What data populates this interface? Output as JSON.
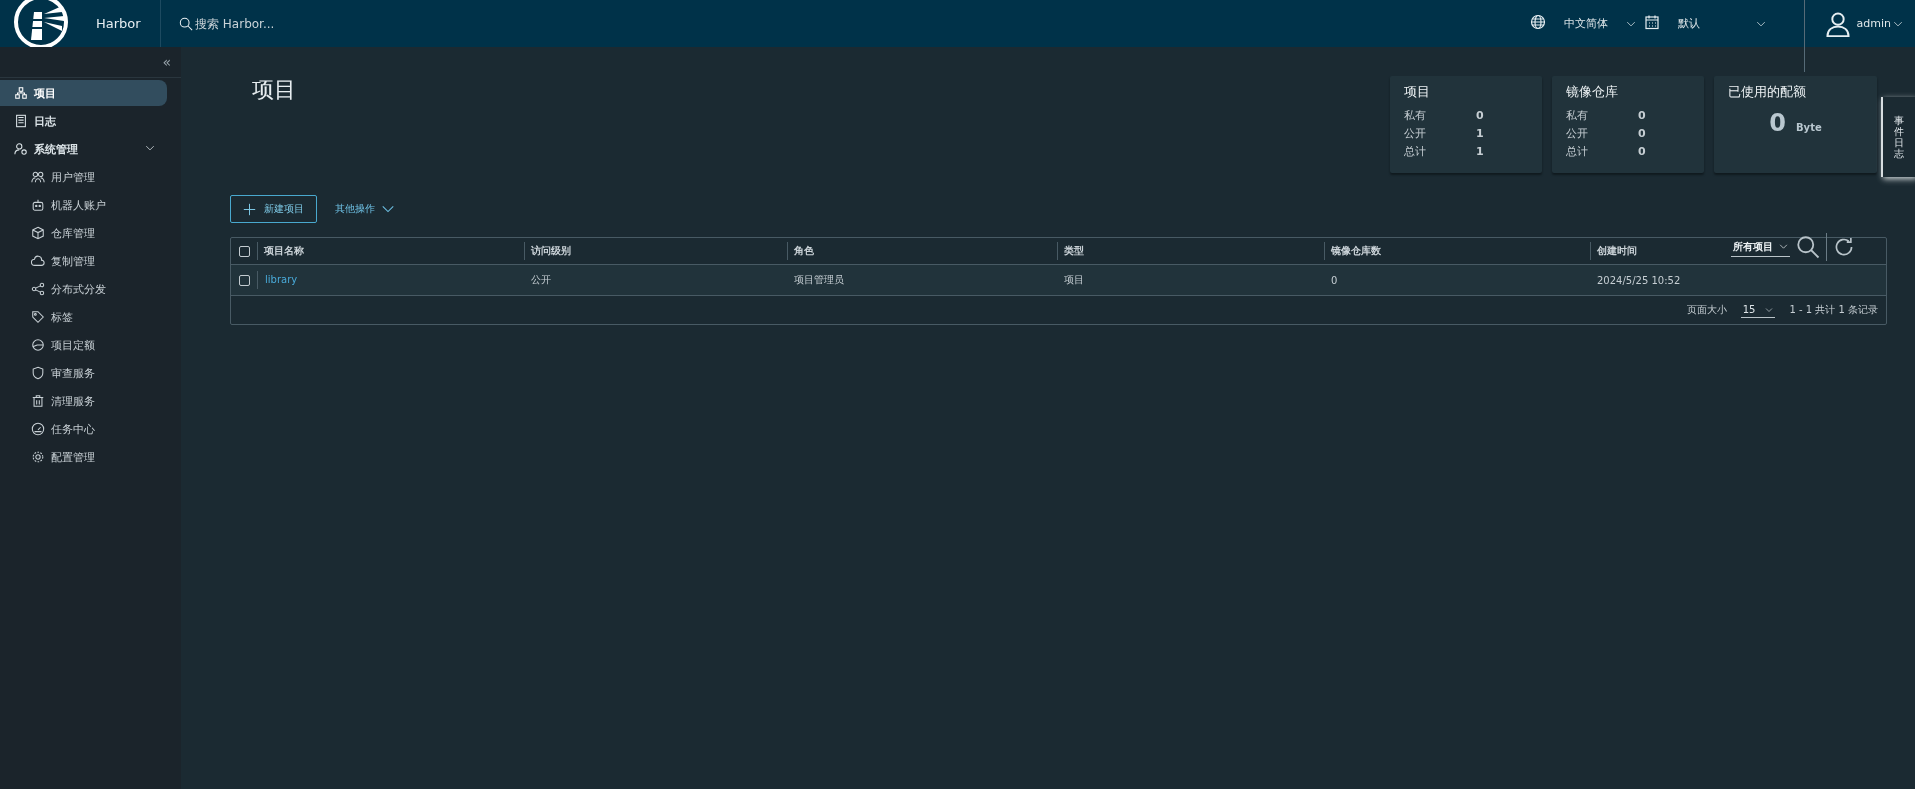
{
  "header": {
    "product": "Harbor",
    "search": {
      "placeholder": "搜索 Harbor..."
    },
    "language": "中文简体",
    "datetime_format": "默认",
    "user": "admin"
  },
  "sidebar": {
    "collapse": "«",
    "items": [
      {
        "label": "项目",
        "selected": true
      },
      {
        "label": "日志",
        "selected": false
      },
      {
        "label": "系统管理",
        "selected": false,
        "expanded": true,
        "children": [
          {
            "label": "用户管理",
            "selected": false
          },
          {
            "label": "机器人账户",
            "selected": false
          },
          {
            "label": "仓库管理",
            "selected": false
          },
          {
            "label": "复制管理",
            "selected": false
          },
          {
            "label": "分布式分发",
            "selected": false
          },
          {
            "label": "标签",
            "selected": false
          },
          {
            "label": "项目定额",
            "selected": false
          },
          {
            "label": "审查服务",
            "selected": false
          },
          {
            "label": "清理服务",
            "selected": false
          },
          {
            "label": "任务中心",
            "selected": false
          },
          {
            "label": "配置管理",
            "selected": false
          }
        ]
      }
    ]
  },
  "page_title": "项目",
  "stats": [
    {
      "title": "项目",
      "rows": [
        {
          "label": "私有",
          "value": "0"
        },
        {
          "label": "公开",
          "value": "1"
        },
        {
          "label": "总计",
          "value": "1"
        }
      ]
    },
    {
      "title": "镜像仓库",
      "rows": [
        {
          "label": "私有",
          "value": "0"
        },
        {
          "label": "公开",
          "value": "0"
        },
        {
          "label": "总计",
          "value": "0"
        }
      ]
    }
  ],
  "quota": {
    "title": "已使用的配额",
    "value": "0",
    "unit": "Byte"
  },
  "side_tab": "事件日志",
  "toolbar": {
    "new_button": "新建项目",
    "actions": "其他操作",
    "filter": "所有项目"
  },
  "table": {
    "select_all": false,
    "columns": [
      "项目名称",
      "访问级别",
      "角色",
      "类型",
      "镜像仓库数",
      "创建时间"
    ],
    "rows": [
      {
        "selected": false,
        "cells": [
          "library",
          "公开",
          "项目管理员",
          "项目",
          "0",
          "2024/5/25 10:52"
        ]
      }
    ],
    "footer": {
      "page_size_label": "页面大小",
      "page_size": "15",
      "summary": "1 - 1 共计 1 条记录"
    }
  }
}
